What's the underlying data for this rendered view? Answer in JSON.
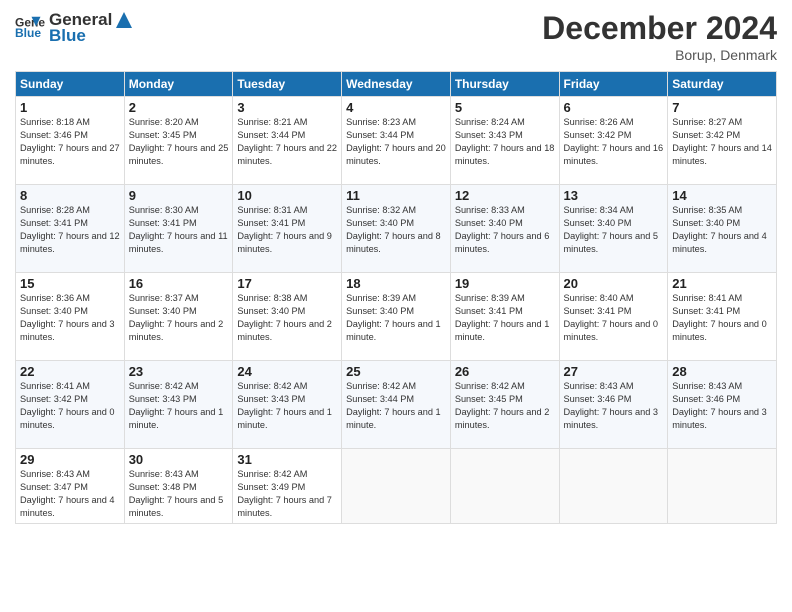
{
  "header": {
    "logo_line1": "General",
    "logo_line2": "Blue",
    "month": "December 2024",
    "location": "Borup, Denmark"
  },
  "days_of_week": [
    "Sunday",
    "Monday",
    "Tuesday",
    "Wednesday",
    "Thursday",
    "Friday",
    "Saturday"
  ],
  "weeks": [
    [
      {
        "day": "1",
        "sunrise": "Sunrise: 8:18 AM",
        "sunset": "Sunset: 3:46 PM",
        "daylight": "Daylight: 7 hours and 27 minutes."
      },
      {
        "day": "2",
        "sunrise": "Sunrise: 8:20 AM",
        "sunset": "Sunset: 3:45 PM",
        "daylight": "Daylight: 7 hours and 25 minutes."
      },
      {
        "day": "3",
        "sunrise": "Sunrise: 8:21 AM",
        "sunset": "Sunset: 3:44 PM",
        "daylight": "Daylight: 7 hours and 22 minutes."
      },
      {
        "day": "4",
        "sunrise": "Sunrise: 8:23 AM",
        "sunset": "Sunset: 3:44 PM",
        "daylight": "Daylight: 7 hours and 20 minutes."
      },
      {
        "day": "5",
        "sunrise": "Sunrise: 8:24 AM",
        "sunset": "Sunset: 3:43 PM",
        "daylight": "Daylight: 7 hours and 18 minutes."
      },
      {
        "day": "6",
        "sunrise": "Sunrise: 8:26 AM",
        "sunset": "Sunset: 3:42 PM",
        "daylight": "Daylight: 7 hours and 16 minutes."
      },
      {
        "day": "7",
        "sunrise": "Sunrise: 8:27 AM",
        "sunset": "Sunset: 3:42 PM",
        "daylight": "Daylight: 7 hours and 14 minutes."
      }
    ],
    [
      {
        "day": "8",
        "sunrise": "Sunrise: 8:28 AM",
        "sunset": "Sunset: 3:41 PM",
        "daylight": "Daylight: 7 hours and 12 minutes."
      },
      {
        "day": "9",
        "sunrise": "Sunrise: 8:30 AM",
        "sunset": "Sunset: 3:41 PM",
        "daylight": "Daylight: 7 hours and 11 minutes."
      },
      {
        "day": "10",
        "sunrise": "Sunrise: 8:31 AM",
        "sunset": "Sunset: 3:41 PM",
        "daylight": "Daylight: 7 hours and 9 minutes."
      },
      {
        "day": "11",
        "sunrise": "Sunrise: 8:32 AM",
        "sunset": "Sunset: 3:40 PM",
        "daylight": "Daylight: 7 hours and 8 minutes."
      },
      {
        "day": "12",
        "sunrise": "Sunrise: 8:33 AM",
        "sunset": "Sunset: 3:40 PM",
        "daylight": "Daylight: 7 hours and 6 minutes."
      },
      {
        "day": "13",
        "sunrise": "Sunrise: 8:34 AM",
        "sunset": "Sunset: 3:40 PM",
        "daylight": "Daylight: 7 hours and 5 minutes."
      },
      {
        "day": "14",
        "sunrise": "Sunrise: 8:35 AM",
        "sunset": "Sunset: 3:40 PM",
        "daylight": "Daylight: 7 hours and 4 minutes."
      }
    ],
    [
      {
        "day": "15",
        "sunrise": "Sunrise: 8:36 AM",
        "sunset": "Sunset: 3:40 PM",
        "daylight": "Daylight: 7 hours and 3 minutes."
      },
      {
        "day": "16",
        "sunrise": "Sunrise: 8:37 AM",
        "sunset": "Sunset: 3:40 PM",
        "daylight": "Daylight: 7 hours and 2 minutes."
      },
      {
        "day": "17",
        "sunrise": "Sunrise: 8:38 AM",
        "sunset": "Sunset: 3:40 PM",
        "daylight": "Daylight: 7 hours and 2 minutes."
      },
      {
        "day": "18",
        "sunrise": "Sunrise: 8:39 AM",
        "sunset": "Sunset: 3:40 PM",
        "daylight": "Daylight: 7 hours and 1 minute."
      },
      {
        "day": "19",
        "sunrise": "Sunrise: 8:39 AM",
        "sunset": "Sunset: 3:41 PM",
        "daylight": "Daylight: 7 hours and 1 minute."
      },
      {
        "day": "20",
        "sunrise": "Sunrise: 8:40 AM",
        "sunset": "Sunset: 3:41 PM",
        "daylight": "Daylight: 7 hours and 0 minutes."
      },
      {
        "day": "21",
        "sunrise": "Sunrise: 8:41 AM",
        "sunset": "Sunset: 3:41 PM",
        "daylight": "Daylight: 7 hours and 0 minutes."
      }
    ],
    [
      {
        "day": "22",
        "sunrise": "Sunrise: 8:41 AM",
        "sunset": "Sunset: 3:42 PM",
        "daylight": "Daylight: 7 hours and 0 minutes."
      },
      {
        "day": "23",
        "sunrise": "Sunrise: 8:42 AM",
        "sunset": "Sunset: 3:43 PM",
        "daylight": "Daylight: 7 hours and 1 minute."
      },
      {
        "day": "24",
        "sunrise": "Sunrise: 8:42 AM",
        "sunset": "Sunset: 3:43 PM",
        "daylight": "Daylight: 7 hours and 1 minute."
      },
      {
        "day": "25",
        "sunrise": "Sunrise: 8:42 AM",
        "sunset": "Sunset: 3:44 PM",
        "daylight": "Daylight: 7 hours and 1 minute."
      },
      {
        "day": "26",
        "sunrise": "Sunrise: 8:42 AM",
        "sunset": "Sunset: 3:45 PM",
        "daylight": "Daylight: 7 hours and 2 minutes."
      },
      {
        "day": "27",
        "sunrise": "Sunrise: 8:43 AM",
        "sunset": "Sunset: 3:46 PM",
        "daylight": "Daylight: 7 hours and 3 minutes."
      },
      {
        "day": "28",
        "sunrise": "Sunrise: 8:43 AM",
        "sunset": "Sunset: 3:46 PM",
        "daylight": "Daylight: 7 hours and 3 minutes."
      }
    ],
    [
      {
        "day": "29",
        "sunrise": "Sunrise: 8:43 AM",
        "sunset": "Sunset: 3:47 PM",
        "daylight": "Daylight: 7 hours and 4 minutes."
      },
      {
        "day": "30",
        "sunrise": "Sunrise: 8:43 AM",
        "sunset": "Sunset: 3:48 PM",
        "daylight": "Daylight: 7 hours and 5 minutes."
      },
      {
        "day": "31",
        "sunrise": "Sunrise: 8:42 AM",
        "sunset": "Sunset: 3:49 PM",
        "daylight": "Daylight: 7 hours and 7 minutes."
      },
      null,
      null,
      null,
      null
    ]
  ]
}
